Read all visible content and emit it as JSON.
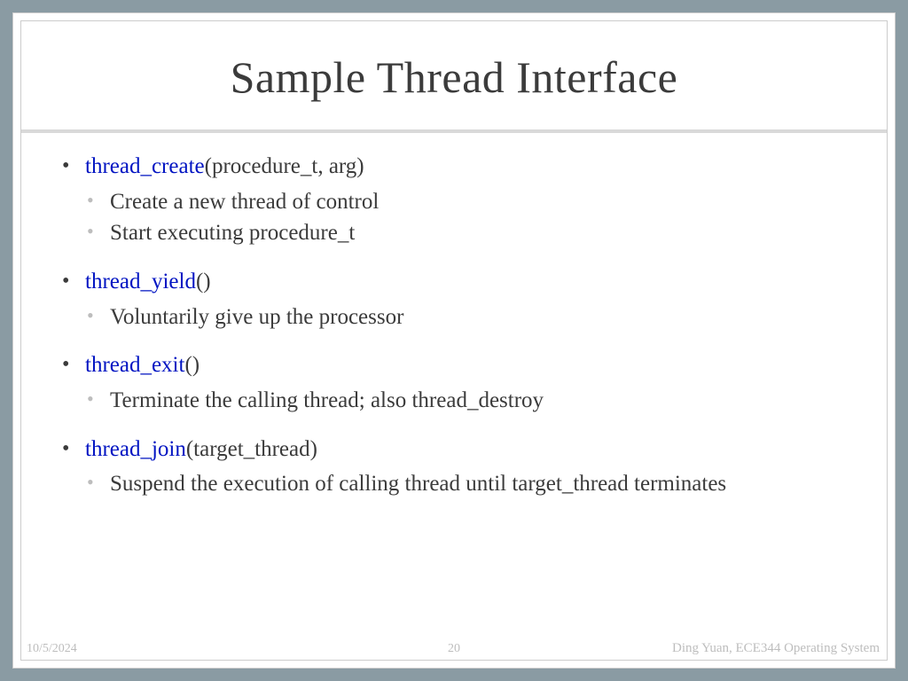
{
  "title": "Sample Thread Interface",
  "items": [
    {
      "fn": "thread_create",
      "args": "(procedure_t, arg)",
      "sub": [
        "Create a new thread of control",
        "Start executing procedure_t"
      ]
    },
    {
      "fn": "thread_yield",
      "args": "()",
      "sub": [
        "Voluntarily give up the processor"
      ]
    },
    {
      "fn": "thread_exit",
      "args": "()",
      "sub": [
        "Terminate the calling thread; also thread_destroy"
      ]
    },
    {
      "fn": "thread_join",
      "args": "(target_thread)",
      "sub": [
        "Suspend the execution of calling thread until target_thread terminates"
      ]
    }
  ],
  "footer": {
    "date": "10/5/2024",
    "page": "20",
    "author": "Ding Yuan, ECE344 Operating System"
  }
}
